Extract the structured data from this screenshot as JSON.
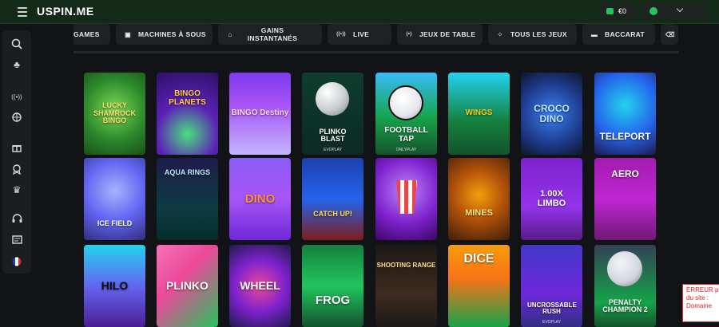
{
  "header": {
    "logo": "USPIN.ME",
    "balance": "€0"
  },
  "sidebar": {
    "items": [
      {
        "icon": "search-icon",
        "glyph": "⚲"
      },
      {
        "icon": "clubs-icon",
        "glyph": "♣"
      },
      {
        "icon": "live-icon",
        "glyph": "((•))"
      },
      {
        "icon": "basketball-icon",
        "glyph": "◍"
      },
      {
        "icon": "gift-icon",
        "glyph": "⊞"
      },
      {
        "icon": "award-icon",
        "glyph": "✪"
      },
      {
        "icon": "crown-icon",
        "glyph": "♛"
      },
      {
        "icon": "headset-icon",
        "glyph": "☊"
      },
      {
        "icon": "news-icon",
        "glyph": "▤"
      },
      {
        "icon": "france-flag-icon",
        "glyph": ""
      }
    ]
  },
  "categories": [
    {
      "label": "GAMES",
      "icon": ""
    },
    {
      "label": "MACHINES À SOUS",
      "icon": "▣"
    },
    {
      "label": "GAINS INSTANTANÉS",
      "icon": "⌂"
    },
    {
      "label": "LIVE",
      "icon": "((•))"
    },
    {
      "label": "JEUX DE TABLE",
      "icon": "(•)"
    },
    {
      "label": "TOUS LES JEUX",
      "icon": "⁘"
    },
    {
      "label": "BACCARAT",
      "icon": "▬"
    },
    {
      "label": "",
      "icon": "⌫"
    }
  ],
  "games": [
    {
      "title": "LUCKY SHAMROCK BINGO",
      "provider": ""
    },
    {
      "title": "BINGO PLANETS",
      "provider": ""
    },
    {
      "title": "BINGO Destiny",
      "provider": ""
    },
    {
      "title": "PLINKO BLAST",
      "provider": "EVOPLAY"
    },
    {
      "title": "FOOTBALL TAP",
      "provider": "ONLYPLAY"
    },
    {
      "title": "WINGS",
      "provider": ""
    },
    {
      "title": "CROCO DINO",
      "provider": ""
    },
    {
      "title": "TELEPORT",
      "provider": ""
    },
    {
      "title": "ICE FIELD",
      "provider": ""
    },
    {
      "title": "AQUA RINGS",
      "provider": ""
    },
    {
      "title": "DINO",
      "provider": ""
    },
    {
      "title": "CATCH UP!",
      "provider": ""
    },
    {
      "title": "",
      "provider": ""
    },
    {
      "title": "MINES",
      "provider": ""
    },
    {
      "title": "1.00X LIMBO",
      "provider": ""
    },
    {
      "title": "AERO",
      "provider": ""
    },
    {
      "title": "HILO",
      "provider": ""
    },
    {
      "title": "PLINKO",
      "provider": ""
    },
    {
      "title": "WHEEL",
      "provider": ""
    },
    {
      "title": "FROG",
      "provider": ""
    },
    {
      "title": "SHOOTING RANGE",
      "provider": ""
    },
    {
      "title": "DICE",
      "provider": ""
    },
    {
      "title": "UNCROSSABLE RUSH",
      "provider": "EVOPLAY"
    },
    {
      "title": "PENALTY CHAMPION 2",
      "provider": ""
    }
  ],
  "error_notice": "ERREUR p du site : Domaine"
}
